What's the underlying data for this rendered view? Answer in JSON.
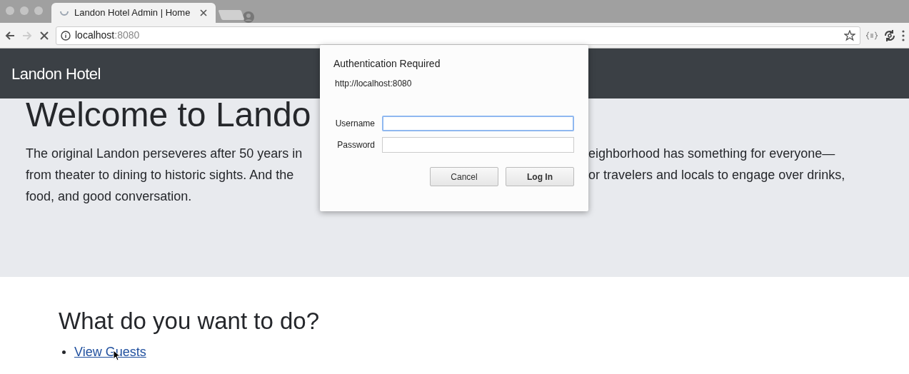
{
  "browser": {
    "tab_title": "Landon Hotel Admin | Home",
    "address_host": "localhost",
    "address_port": ":8080"
  },
  "navbar": {
    "brand": "Landon Hotel"
  },
  "hero": {
    "title": "Welcome to Lando",
    "lines": [
      {
        "left": "The original Landon perseveres after 50 years in",
        "right": "eighborhood has something for everyone—"
      },
      {
        "left": "from theater to dining to historic sights. And the",
        "right": "or travelers and locals to engage over drinks,"
      },
      {
        "left": "food, and good conversation."
      }
    ]
  },
  "actions": {
    "heading": "What do you want to do?",
    "links": [
      "View Guests"
    ]
  },
  "dialog": {
    "title": "Authentication Required",
    "origin": "http://localhost:8080",
    "fields": [
      {
        "label": "Username",
        "focused": true
      },
      {
        "label": "Password",
        "focused": false
      }
    ],
    "buttons": [
      {
        "label": "Cancel",
        "default": false
      },
      {
        "label": "Log In",
        "default": true
      }
    ]
  }
}
